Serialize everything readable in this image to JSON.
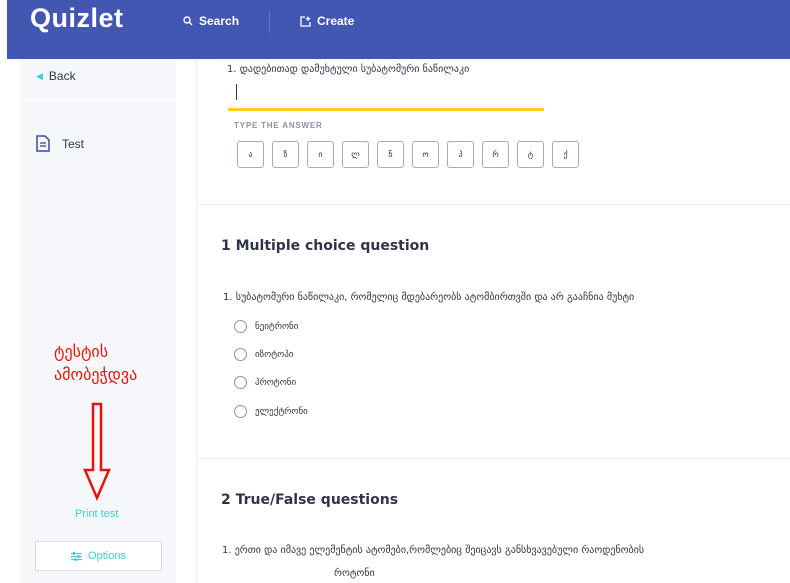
{
  "header": {
    "logo": "Quizlet",
    "search_label": "Search",
    "create_label": "Create"
  },
  "sidebar": {
    "back_label": "Back",
    "test_label": "Test",
    "print_label": "Print test",
    "options_label": "Options",
    "annotation_line1": "ტესტის",
    "annotation_line2": "ამობეჭდვა"
  },
  "written": {
    "question": "1. დადებითად დამუხტული სუბატომური ნაწილაკი",
    "type_label": "TYPE THE ANSWER",
    "letters": [
      "ა",
      "ზ",
      "ი",
      "ლ",
      "ნ",
      "ო",
      "პ",
      "რ",
      "ტ",
      "ქ"
    ]
  },
  "multiple_choice": {
    "title": "1 Multiple choice question",
    "question": "1. სუბატომური ნაწილაკი, რომელიც მდებარეობს ატომბირთვში და არ გააჩნია მუხტი",
    "choices": [
      "ნეიტრონი",
      "იზოტოპი",
      "პროტონი",
      "ელექტრონი"
    ]
  },
  "true_false": {
    "title": "2 True/False questions",
    "question_line1": "1. ერთი და იმავე ელემენტის ატომები,რომლებიც შეიცავს განსხვავებული რაოდენობის",
    "question_line2": "როტონი"
  },
  "colors": {
    "header_bg": "#4257b2",
    "accent": "#3ccfcf",
    "answer_underline": "#ffcd1f",
    "annotation": "#e5140a"
  }
}
